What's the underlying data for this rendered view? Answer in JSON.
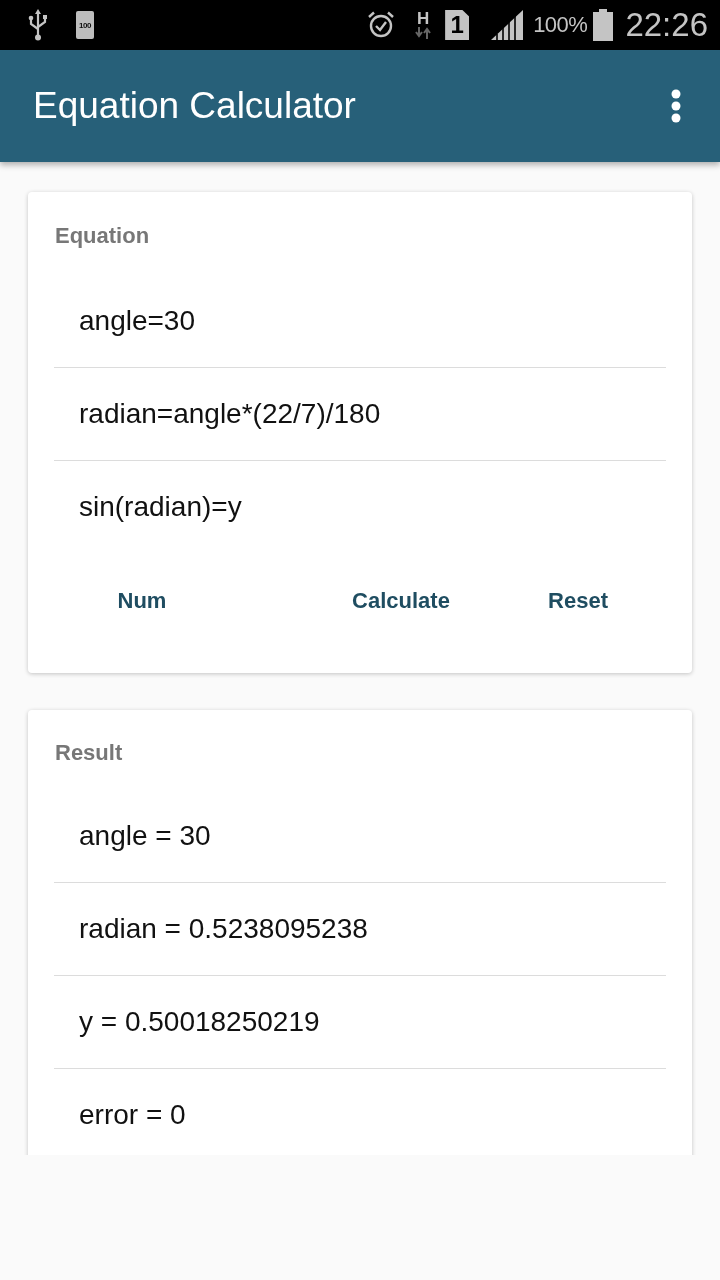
{
  "status_bar": {
    "battery_saver": "100",
    "network_type": "H",
    "sim_slot": "1",
    "battery": "100%",
    "time": "22:26"
  },
  "app_bar": {
    "title": "Equation Calculator"
  },
  "equation_card": {
    "heading": "Equation",
    "lines": [
      "angle=30",
      "radian=angle*(22/7)/180",
      "sin(radian)=y"
    ],
    "buttons": [
      "Num",
      "Calculate",
      "Reset"
    ]
  },
  "result_card": {
    "heading": "Result",
    "lines": [
      "angle = 30",
      "radian = 0.5238095238",
      "y = 0.50018250219",
      "error = 0"
    ]
  }
}
